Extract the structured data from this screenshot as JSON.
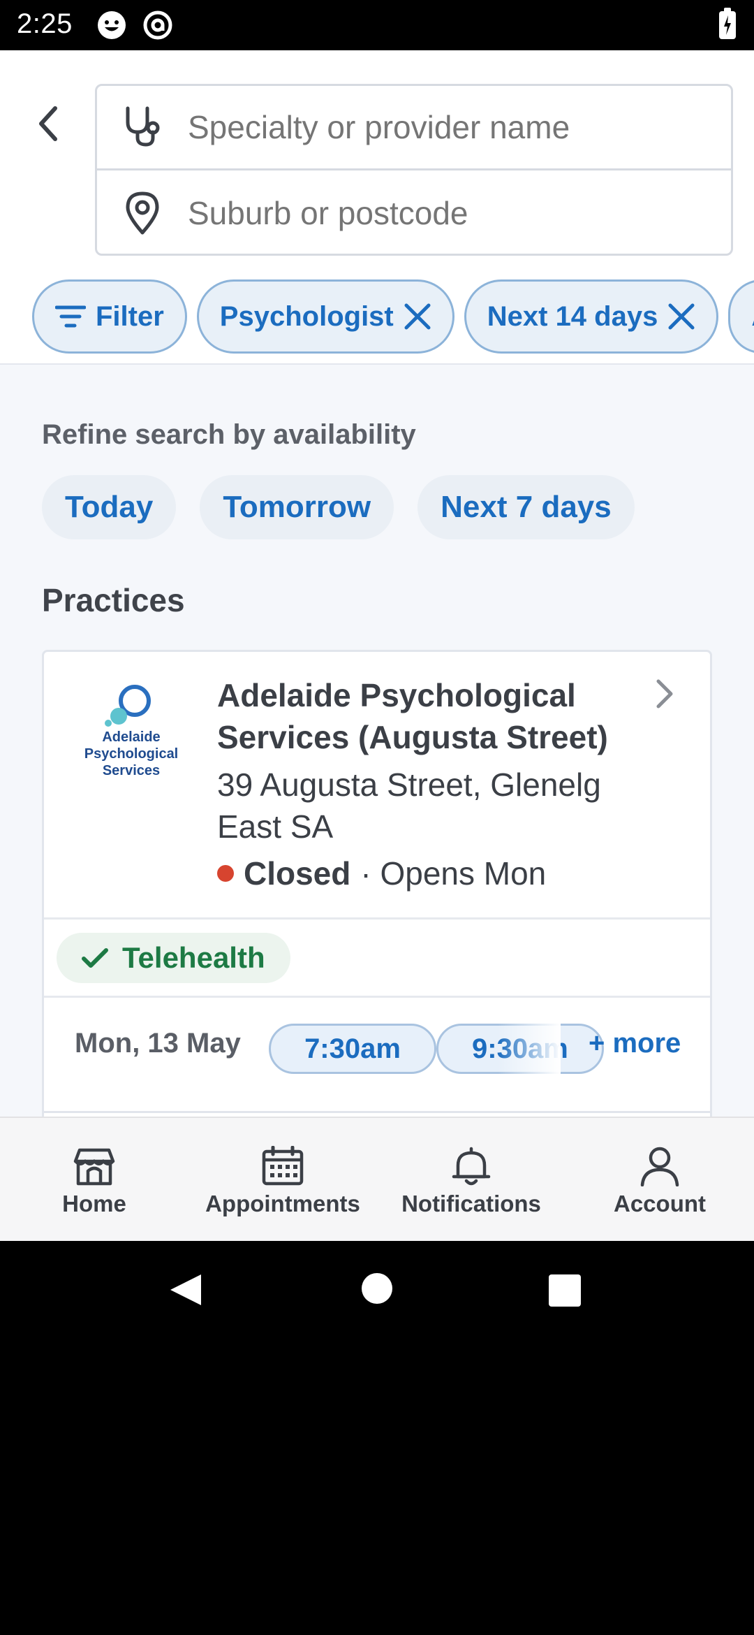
{
  "status_bar": {
    "time": "2:25"
  },
  "search": {
    "provider_placeholder": "Specialty or provider name",
    "location_placeholder": "Suburb or postcode"
  },
  "chips": [
    {
      "label": "Filter"
    },
    {
      "label": "Psychologist"
    },
    {
      "label": "Next 14 days"
    },
    {
      "label": "A"
    }
  ],
  "refine": {
    "label": "Refine search by availability",
    "options": [
      "Today",
      "Tomorrow",
      "Next 7 days"
    ]
  },
  "practices": {
    "title": "Practices",
    "items": [
      {
        "logo_text": "Adelaide Psychological Services",
        "name": "Adelaide Psychological Services (Augusta Street)",
        "address": "39 Augusta Street, Glenelg East SA",
        "status": "Closed",
        "status_detail": "· Opens Mon",
        "status_color": "#d7442f",
        "badge": "Telehealth",
        "appointment_date": "Mon, 13 May",
        "slots": [
          "7:30am",
          "9:30am"
        ],
        "more_label": "+ more"
      }
    ]
  },
  "bottom_nav": [
    {
      "label": "Home",
      "icon": "home-icon"
    },
    {
      "label": "Appointments",
      "icon": "calendar-icon"
    },
    {
      "label": "Notifications",
      "icon": "bell-icon"
    },
    {
      "label": "Account",
      "icon": "account-icon"
    }
  ],
  "colors": {
    "accent": "#1b6cbf",
    "telehealth": "#1d7a44"
  }
}
